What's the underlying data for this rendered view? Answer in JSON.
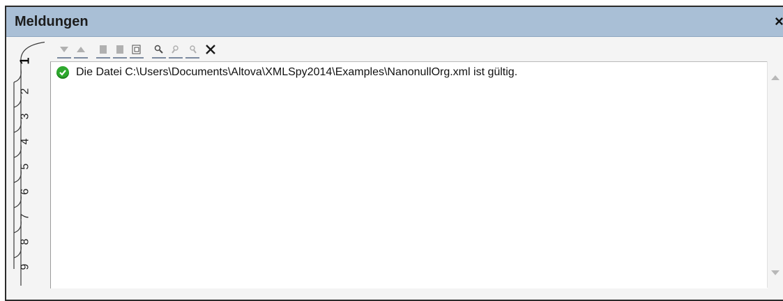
{
  "window": {
    "title": "Meldungen",
    "close_glyph": "×"
  },
  "tabs": [
    {
      "label": "1",
      "active": true
    },
    {
      "label": "2",
      "active": false
    },
    {
      "label": "3",
      "active": false
    },
    {
      "label": "4",
      "active": false
    },
    {
      "label": "5",
      "active": false
    },
    {
      "label": "6",
      "active": false
    },
    {
      "label": "7",
      "active": false
    },
    {
      "label": "8",
      "active": false
    },
    {
      "label": "9",
      "active": false
    }
  ],
  "toolbar": {
    "buttons": [
      {
        "icon": "next-message-icon",
        "enabled": false
      },
      {
        "icon": "previous-message-icon",
        "enabled": false
      },
      {
        "icon": "copy-message-icon",
        "enabled": false
      },
      {
        "icon": "copy-message-with-children-icon",
        "enabled": false
      },
      {
        "icon": "copy-all-messages-icon",
        "enabled": true
      },
      {
        "icon": "find-icon",
        "enabled": true
      },
      {
        "icon": "find-previous-icon",
        "enabled": false
      },
      {
        "icon": "find-next-icon",
        "enabled": false
      },
      {
        "icon": "clear-icon",
        "enabled": true
      }
    ]
  },
  "messages": [
    {
      "status": "valid",
      "icon": "check-circle-icon",
      "text": "Die Datei C:\\Users\\Documents\\Altova\\XMLSpy2014\\Examples\\NanonullOrg.xml ist gültig."
    }
  ],
  "colors": {
    "titlebar": "#a9bfd6",
    "ok": "#2ea82e",
    "disabled_icon": "#b0b0b0",
    "enabled_icon": "#4a4a4a"
  }
}
